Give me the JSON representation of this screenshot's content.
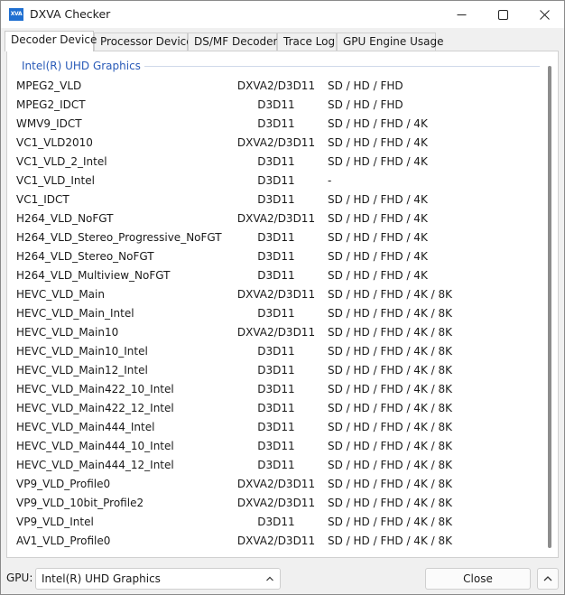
{
  "window": {
    "title": "DXVA Checker",
    "icon_text": "XVA"
  },
  "tabs": [
    {
      "label": "Decoder Device"
    },
    {
      "label": "Processor Device"
    },
    {
      "label": "DS/MF Decoder"
    },
    {
      "label": "Trace Log"
    },
    {
      "label": "GPU Engine Usage"
    }
  ],
  "group": {
    "title": "Intel(R) UHD Graphics"
  },
  "decoders": [
    {
      "name": "MPEG2_VLD",
      "api": "DXVA2/D3D11",
      "res": "SD / HD / FHD"
    },
    {
      "name": "MPEG2_IDCT",
      "api": "D3D11",
      "res": "SD / HD / FHD"
    },
    {
      "name": "WMV9_IDCT",
      "api": "D3D11",
      "res": "SD / HD / FHD / 4K"
    },
    {
      "name": "VC1_VLD2010",
      "api": "DXVA2/D3D11",
      "res": "SD / HD / FHD / 4K"
    },
    {
      "name": "VC1_VLD_2_Intel",
      "api": "D3D11",
      "res": "SD / HD / FHD / 4K"
    },
    {
      "name": "VC1_VLD_Intel",
      "api": "D3D11",
      "res": "-"
    },
    {
      "name": "VC1_IDCT",
      "api": "D3D11",
      "res": "SD / HD / FHD / 4K"
    },
    {
      "name": "H264_VLD_NoFGT",
      "api": "DXVA2/D3D11",
      "res": "SD / HD / FHD / 4K"
    },
    {
      "name": "H264_VLD_Stereo_Progressive_NoFGT",
      "api": "D3D11",
      "res": "SD / HD / FHD / 4K"
    },
    {
      "name": "H264_VLD_Stereo_NoFGT",
      "api": "D3D11",
      "res": "SD / HD / FHD / 4K"
    },
    {
      "name": "H264_VLD_Multiview_NoFGT",
      "api": "D3D11",
      "res": "SD / HD / FHD / 4K"
    },
    {
      "name": "HEVC_VLD_Main",
      "api": "DXVA2/D3D11",
      "res": "SD / HD / FHD / 4K / 8K"
    },
    {
      "name": "HEVC_VLD_Main_Intel",
      "api": "D3D11",
      "res": "SD / HD / FHD / 4K / 8K"
    },
    {
      "name": "HEVC_VLD_Main10",
      "api": "DXVA2/D3D11",
      "res": "SD / HD / FHD / 4K / 8K"
    },
    {
      "name": "HEVC_VLD_Main10_Intel",
      "api": "D3D11",
      "res": "SD / HD / FHD / 4K / 8K"
    },
    {
      "name": "HEVC_VLD_Main12_Intel",
      "api": "D3D11",
      "res": "SD / HD / FHD / 4K / 8K"
    },
    {
      "name": "HEVC_VLD_Main422_10_Intel",
      "api": "D3D11",
      "res": "SD / HD / FHD / 4K / 8K"
    },
    {
      "name": "HEVC_VLD_Main422_12_Intel",
      "api": "D3D11",
      "res": "SD / HD / FHD / 4K / 8K"
    },
    {
      "name": "HEVC_VLD_Main444_Intel",
      "api": "D3D11",
      "res": "SD / HD / FHD / 4K / 8K"
    },
    {
      "name": "HEVC_VLD_Main444_10_Intel",
      "api": "D3D11",
      "res": "SD / HD / FHD / 4K / 8K"
    },
    {
      "name": "HEVC_VLD_Main444_12_Intel",
      "api": "D3D11",
      "res": "SD / HD / FHD / 4K / 8K"
    },
    {
      "name": "VP9_VLD_Profile0",
      "api": "DXVA2/D3D11",
      "res": "SD / HD / FHD / 4K / 8K"
    },
    {
      "name": "VP9_VLD_10bit_Profile2",
      "api": "DXVA2/D3D11",
      "res": "SD / HD / FHD / 4K / 8K"
    },
    {
      "name": "VP9_VLD_Intel",
      "api": "D3D11",
      "res": "SD / HD / FHD / 4K / 8K"
    },
    {
      "name": "AV1_VLD_Profile0",
      "api": "DXVA2/D3D11",
      "res": "SD / HD / FHD / 4K / 8K"
    }
  ],
  "footer": {
    "gpu_label": "GPU:",
    "gpu_selected": "Intel(R) UHD Graphics",
    "close_label": "Close"
  }
}
